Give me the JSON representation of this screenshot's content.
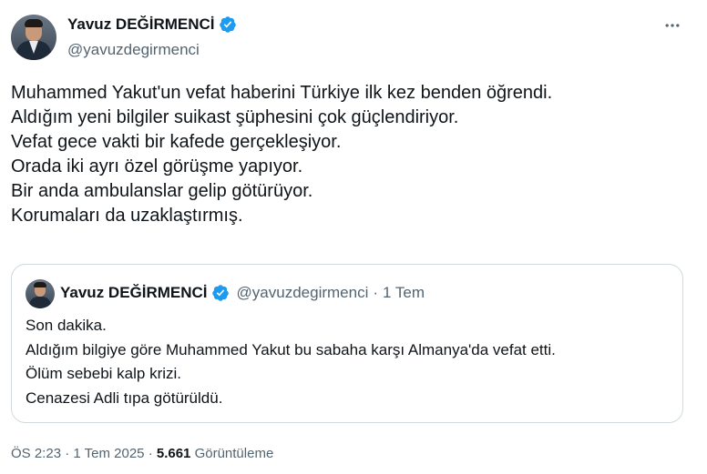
{
  "author": {
    "name": "Yavuz DEĞİRMENCİ",
    "handle": "@yavuzdegirmenci",
    "verified_badge_color": "#1d9bf0"
  },
  "more_icon": "more-horizontal-icon",
  "tweet": {
    "lines": [
      "Muhammed Yakut'un vefat haberini Türkiye ilk kez benden öğrendi.",
      "Aldığım yeni bilgiler suikast şüphesini çok güçlendiriyor.",
      "Vefat gece vakti bir kafede gerçekleşiyor.",
      "Orada iki ayrı özel görüşme yapıyor.",
      "Bir anda ambulanslar gelip götürüyor.",
      "Korumaları da uzaklaştırmış."
    ]
  },
  "quote": {
    "name": "Yavuz DEĞİRMENCİ",
    "handle": "@yavuzdegirmenci",
    "separator": "·",
    "date": "1 Tem",
    "lines": [
      "Son dakika.",
      "Aldığım bilgiye göre Muhammed Yakut bu sabaha karşı Almanya'da vefat etti.",
      "Ölüm sebebi kalp krizi.",
      "Cenazesi Adli tıpa götürüldü."
    ]
  },
  "meta": {
    "time": "ÖS 2:23",
    "sep1": "·",
    "date": "1 Tem 2025",
    "sep2": "·",
    "views_count": "5.661",
    "views_label": "Görüntüleme"
  },
  "colors": {
    "text": "#0f1419",
    "secondary": "#536471",
    "border": "#cfd9de",
    "verified": "#1d9bf0"
  }
}
